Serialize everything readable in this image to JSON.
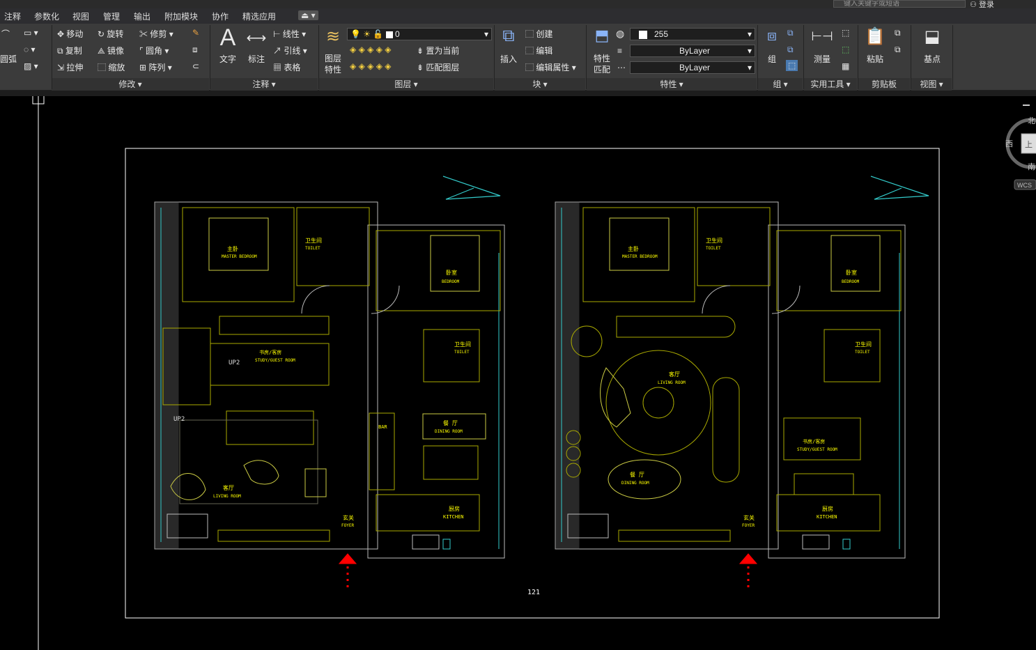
{
  "search": {
    "placeholder": "键入关键字或短语"
  },
  "login_label": "登录",
  "menu": [
    "注释",
    "参数化",
    "视图",
    "管理",
    "输出",
    "附加模块",
    "协作",
    "精选应用"
  ],
  "ribbon": {
    "draw_partial": "圆弧",
    "modify": {
      "move": "移动",
      "rotate": "旋转",
      "trim": "修剪",
      "copy": "复制",
      "mirror": "镜像",
      "fillet": "圆角",
      "stretch": "拉伸",
      "scale": "缩放",
      "array": "阵列",
      "panel": "修改"
    },
    "annotation": {
      "text": "文字",
      "dimension": "标注",
      "linear": "线性",
      "leader": "引线",
      "table": "表格",
      "panel": "注释"
    },
    "layers": {
      "properties": "图层\n特性",
      "current_layer": "0",
      "make_current": "置为当前",
      "match_layer": "匹配图层",
      "panel": "图层"
    },
    "block": {
      "insert": "插入",
      "create": "创建",
      "edit": "编辑",
      "edit_attr": "编辑属性",
      "panel": "块"
    },
    "properties": {
      "match": "特性\n匹配",
      "color": "255",
      "linetype": "ByLayer",
      "lineweight": "ByLayer",
      "panel": "特性"
    },
    "groups": {
      "group": "组",
      "panel": "组"
    },
    "utilities": {
      "measure": "测量",
      "panel": "实用工具"
    },
    "clipboard": {
      "paste": "粘贴",
      "panel": "剪贴板"
    },
    "view": {
      "base": "基点",
      "panel": "视图"
    }
  },
  "viewcube": {
    "north": "北",
    "west": "西",
    "south": "南",
    "top": "上",
    "wcs": "WCS"
  },
  "drawing": {
    "page_number": "121",
    "plan_left": {
      "master_bedroom": "主卧",
      "master_bedroom_en": "MASTER BEDROOM",
      "toilet": "卫生间",
      "toilet_en": "TOILET",
      "bedroom": "卧室",
      "bedroom_en": "BEDROOM",
      "study": "书房/客房",
      "study_en": "STUDY/GUEST ROOM",
      "toilet2": "卫生间",
      "toilet2_en": "TOILET",
      "up1": "UP2",
      "up2": "UP2",
      "bar": "BAR",
      "dining": "餐 厅",
      "dining_en": "DINING ROOM",
      "living": "客厅",
      "living_en": "LIVING ROOM",
      "foyer": "玄关",
      "foyer_en": "FOYER",
      "kitchen": "厨房",
      "kitchen_en": "KITCHEN"
    },
    "plan_right": {
      "master_bedroom": "主卧",
      "master_bedroom_en": "MASTER BEDROOM",
      "toilet": "卫生间",
      "toilet_en": "TOILET",
      "bedroom": "卧室",
      "bedroom_en": "BEDROOM",
      "living": "客厅",
      "living_en": "LIVING ROOM",
      "toilet2": "卫生间",
      "toilet2_en": "TOILET",
      "study": "书房/客房",
      "study_en": "STUDY/GUEST ROOM",
      "dining": "餐 厅",
      "dining_en": "DINING ROOM",
      "foyer": "玄关",
      "foyer_en": "FOYER",
      "kitchen": "厨房",
      "kitchen_en": "KITCHEN"
    }
  }
}
